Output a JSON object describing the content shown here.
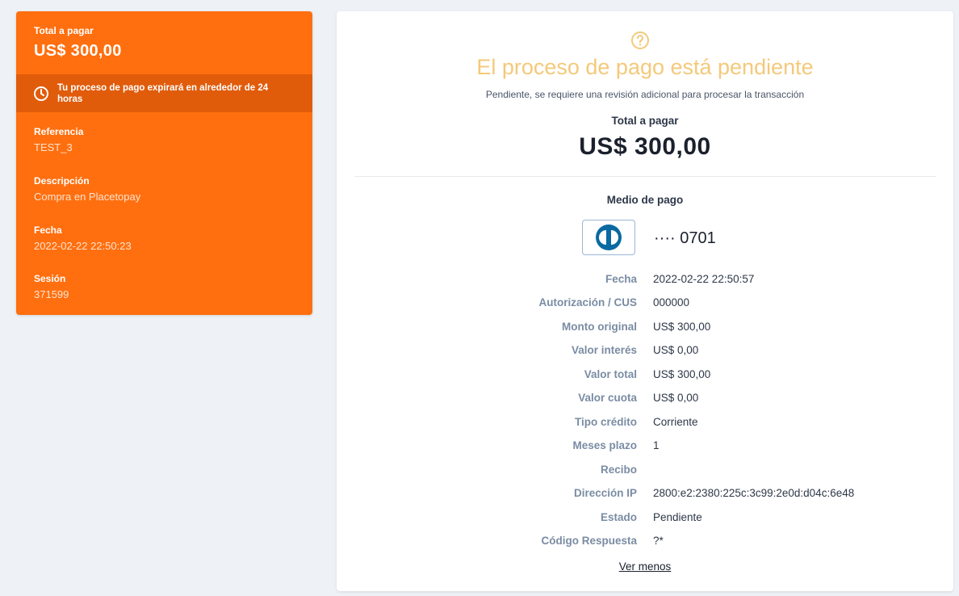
{
  "summary": {
    "total_label": "Total a pagar",
    "total_amount": "US$ 300,00",
    "expire_message": "Tu proceso de pago expirará en alrededor de 24 horas",
    "fields": [
      {
        "label": "Referencia",
        "value": "TEST_3"
      },
      {
        "label": "Descripción",
        "value": "Compra en Placetopay"
      },
      {
        "label": "Fecha",
        "value": "2022-02-22 22:50:23"
      },
      {
        "label": "Sesión",
        "value": "371599"
      }
    ]
  },
  "result": {
    "status_icon": "question-circle-icon",
    "title": "El proceso de pago está pendiente",
    "subtitle": "Pendiente, se requiere una revisión adicional para procesar la transacción",
    "total_label": "Total a pagar",
    "total_amount": "US$ 300,00",
    "payment_method_title": "Medio de pago",
    "card_brand_icon": "diners-club-icon",
    "card_mask": "···· 0701",
    "details": [
      {
        "key": "Fecha",
        "value": "2022-02-22 22:50:57"
      },
      {
        "key": "Autorización / CUS",
        "value": "000000"
      },
      {
        "key": "Monto original",
        "value": "US$ 300,00"
      },
      {
        "key": "Valor interés",
        "value": "US$ 0,00"
      },
      {
        "key": "Valor total",
        "value": "US$ 300,00"
      },
      {
        "key": "Valor cuota",
        "value": "US$ 0,00"
      },
      {
        "key": "Tipo crédito",
        "value": "Corriente"
      },
      {
        "key": "Meses plazo",
        "value": "1"
      },
      {
        "key": "Recibo",
        "value": ""
      },
      {
        "key": "Dirección IP",
        "value": "2800:e2:2380:225c:3c99:2e0d:d04c:6e48"
      },
      {
        "key": "Estado",
        "value": "Pendiente"
      },
      {
        "key": "Código Respuesta",
        "value": "?*"
      }
    ],
    "toggle_label": "Ver menos"
  },
  "colors": {
    "brand_orange": "#ff6f0f",
    "expire_bar": "#e05c0b",
    "pending_yellow": "#f4c97a",
    "diners_blue": "#0a6aa1"
  }
}
